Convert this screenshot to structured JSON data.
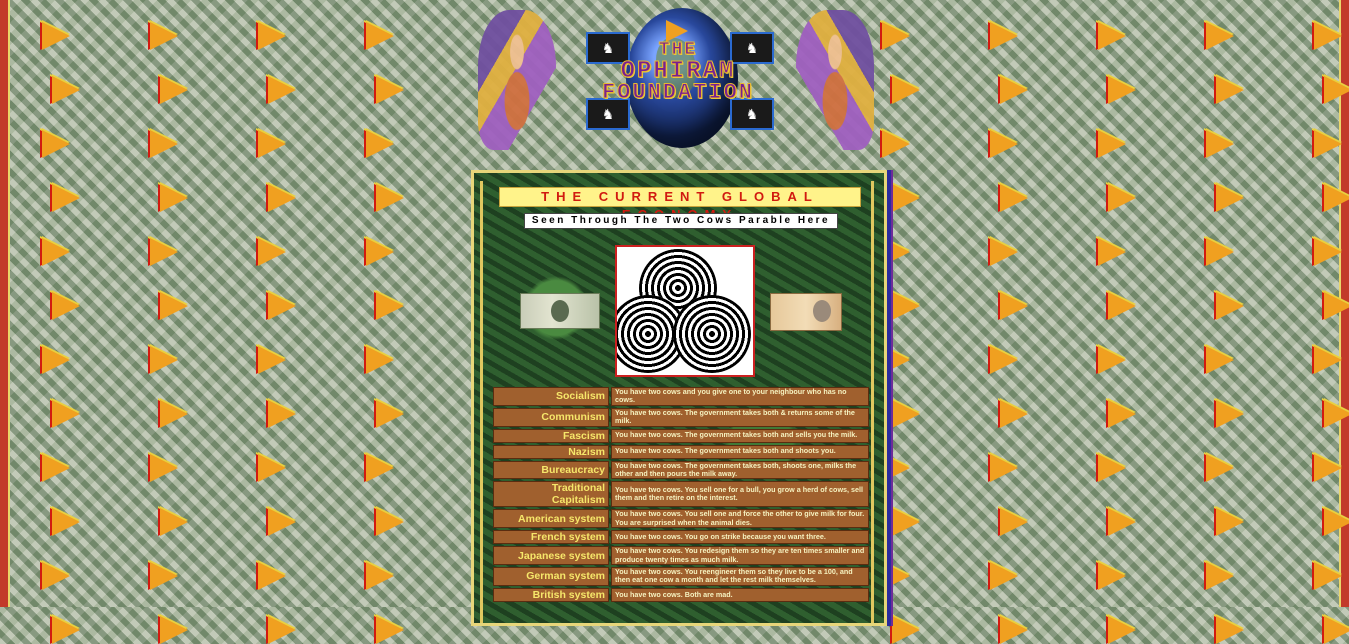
{
  "logo": {
    "line1": "THE",
    "line2": "OPHIRAM",
    "line3": "FOUNDATION"
  },
  "title": "THE CURRENT GLOBAL ECONOMY",
  "subtitle": "Seen Through The Two Cows Parable Here",
  "systems": [
    {
      "name": "Socialism",
      "text": "You have two cows and you give one to your neighbour who has no cows."
    },
    {
      "name": "Communism",
      "text": "You have two cows. The government takes both & returns some of the milk."
    },
    {
      "name": "Fascism",
      "text": "You have two cows. The government takes both and sells you the milk."
    },
    {
      "name": "Nazism",
      "text": "You have two cows. The government takes both and shoots you."
    },
    {
      "name": "Bureaucracy",
      "text": "You have two cows. The government takes both, shoots one, milks the other and then pours the milk away."
    },
    {
      "name": "Traditional Capitalism",
      "text": "You have two cows. You sell one for a bull, you grow a herd of cows, sell them and then retire on the interest."
    },
    {
      "name": "American system",
      "text": "You have two cows. You sell one and force the other to give milk for four. You are surprised when the animal dies."
    },
    {
      "name": "French system",
      "text": "You have two cows. You go on strike because you want three."
    },
    {
      "name": "Japanese system",
      "text": "You have two cows. You redesign them so they are ten times smaller and produce twenty times as much milk."
    },
    {
      "name": "German system",
      "text": "You have two cows. You reengineer them so they live to be a 100, and then eat one cow a month and let the rest milk themselves."
    },
    {
      "name": "British system",
      "text": "You have two cows. Both are mad."
    }
  ]
}
